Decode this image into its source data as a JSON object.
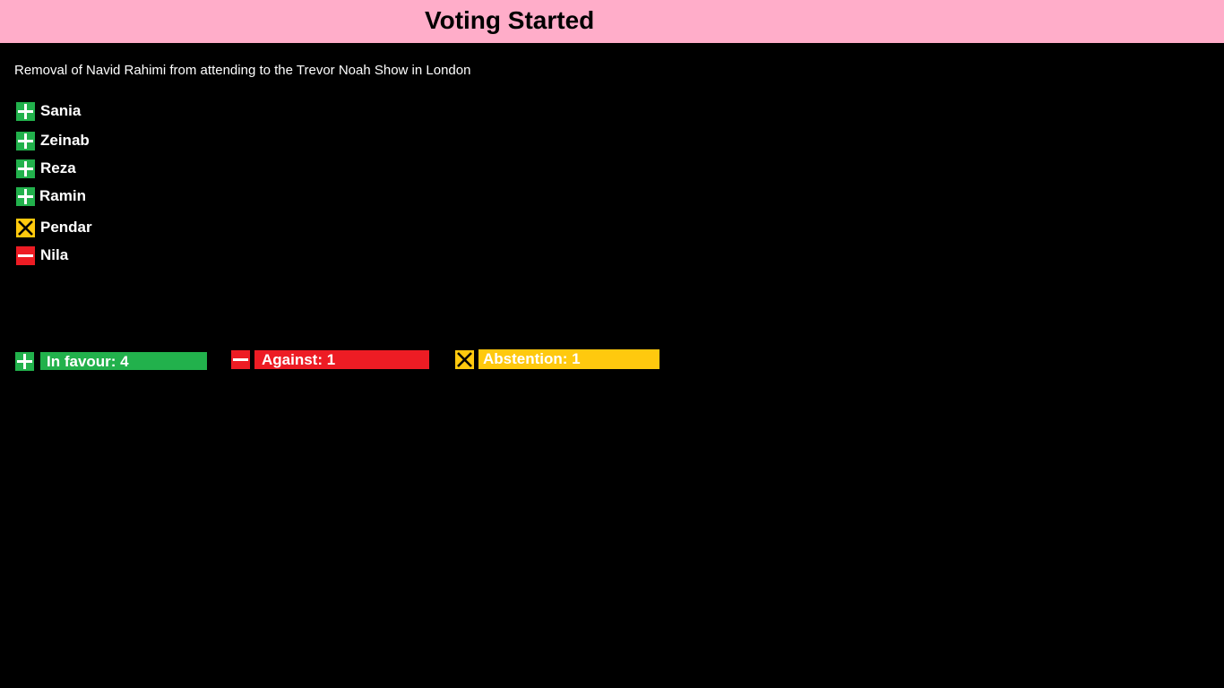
{
  "header": {
    "title": "Voting Started"
  },
  "motion": {
    "text": "Removal of Navid Rahimi from attending to the Trevor Noah Show in London"
  },
  "colors": {
    "header_bg": "#ffadc9",
    "in_favour": "#22b14c",
    "against": "#ed1c24",
    "abstention": "#ffc90e"
  },
  "voters": [
    {
      "name": "Sania",
      "vote": "in-favour",
      "icon": "plus-icon"
    },
    {
      "name": "Zeinab",
      "vote": "in-favour",
      "icon": "plus-icon"
    },
    {
      "name": "Reza",
      "vote": "in-favour",
      "icon": "plus-icon"
    },
    {
      "name": "Ramin",
      "vote": "in-favour",
      "icon": "plus-icon"
    },
    {
      "name": "Pendar",
      "vote": "abstention",
      "icon": "cross-icon"
    },
    {
      "name": "Nila",
      "vote": "against",
      "icon": "minus-icon"
    }
  ],
  "tally": {
    "in_favour": {
      "label": "In favour: 4",
      "count": 4,
      "icon": "plus-icon"
    },
    "against": {
      "label": "Against: 1",
      "count": 1,
      "icon": "minus-icon"
    },
    "abstention": {
      "label": "Abstention: 1",
      "count": 1,
      "icon": "cross-icon"
    }
  }
}
